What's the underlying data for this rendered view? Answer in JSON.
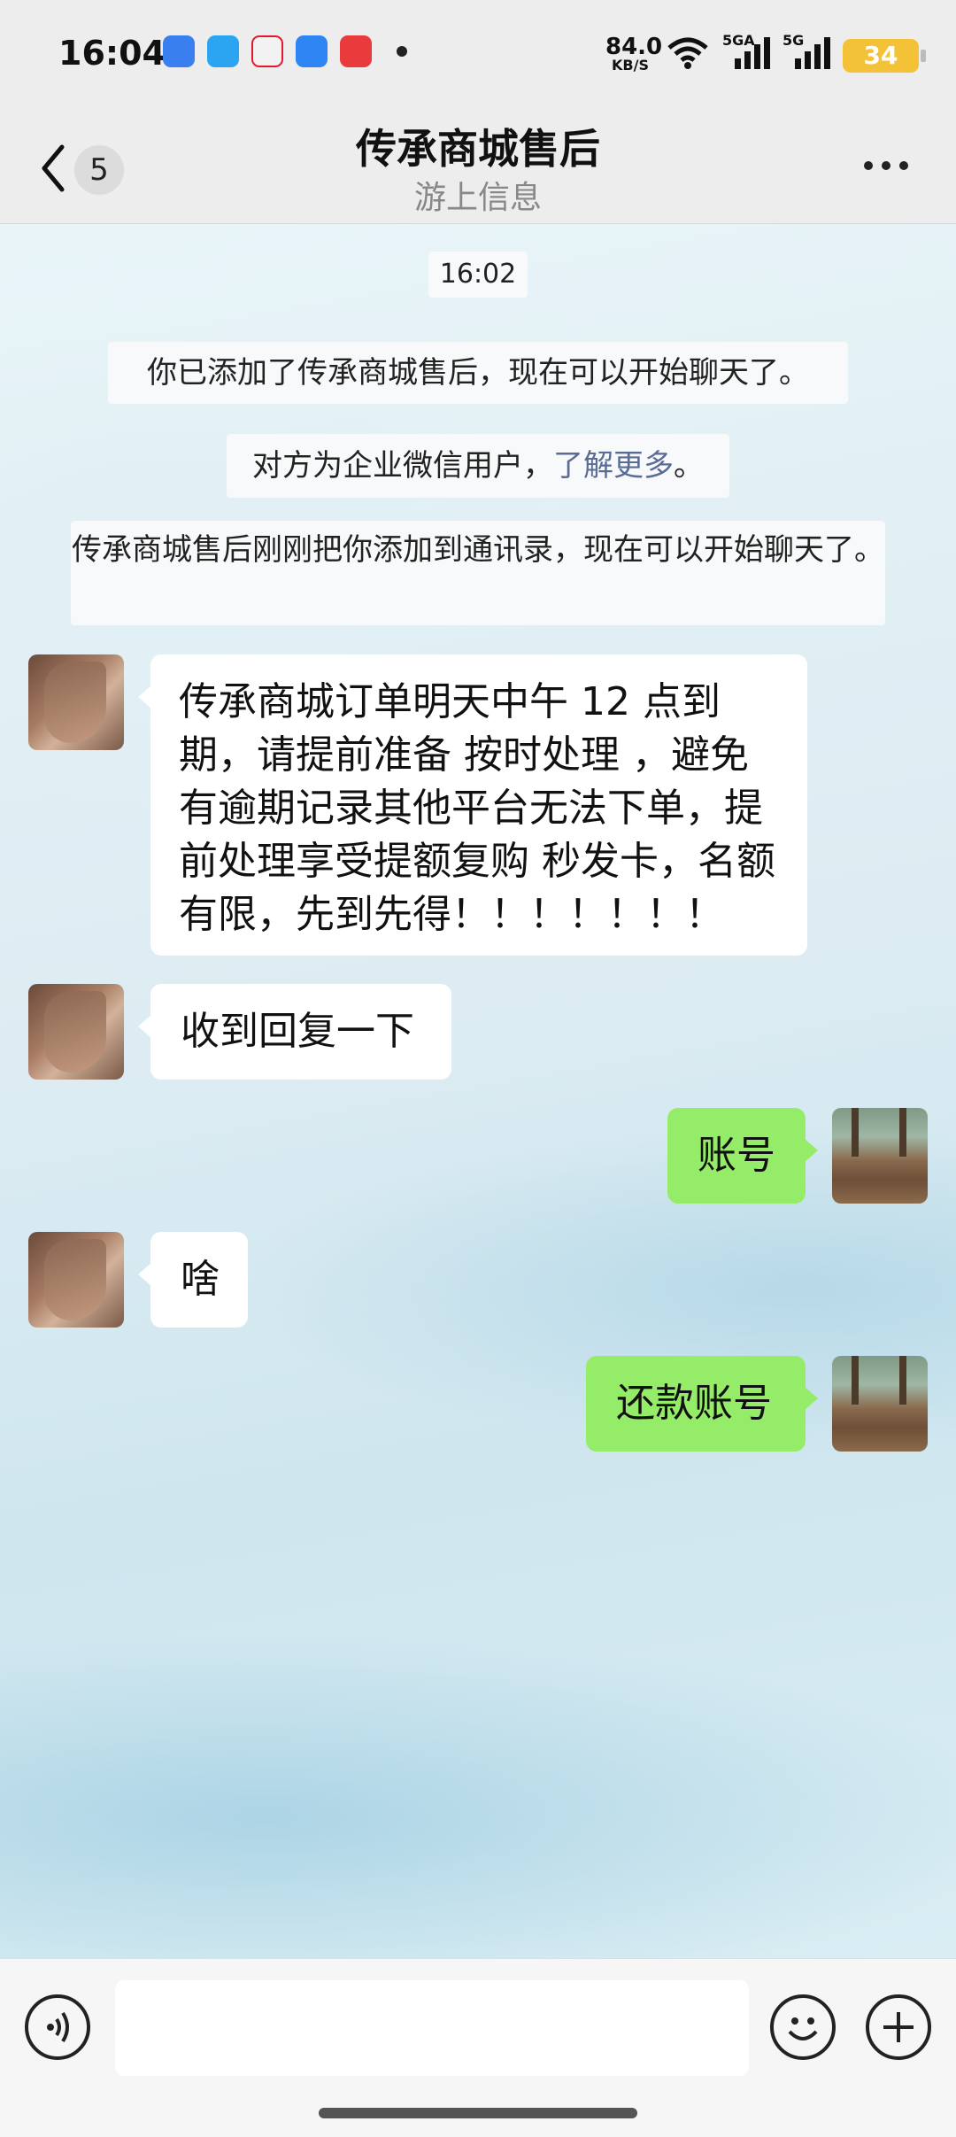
{
  "status_bar": {
    "time": "16:04",
    "net_speed_value": "84.0",
    "net_speed_unit": "KB/S",
    "signal1_label": "5GA",
    "signal2_label": "5G",
    "battery": "34",
    "app_icons": [
      "baidu-map-icon",
      "mobile-app-icon",
      "weibo-icon",
      "feather-icon",
      "618-sale-icon"
    ]
  },
  "nav": {
    "back_badge": "5",
    "title": "传承商城售后",
    "subtitle": "游上信息"
  },
  "chat": {
    "timestamp": "16:02",
    "system_added": "你已添加了传承商城售后，现在可以开始聊天了。",
    "system_wecom_prefix": "对方为企业微信用户，",
    "system_wecom_link": "了解更多",
    "system_wecom_suffix": "。",
    "system_contacts": "传承商城售后刚刚把你添加到通讯录，现在可以开始聊天了。",
    "messages": [
      {
        "side": "left",
        "text": "传承商城订单明天中午 12 点到期，请提前准备 按时处理 ，避免有逾期记录其他平台无法下单，提前处理享受提额复购 秒发卡，名额有限，先到先得！！！！！！！"
      },
      {
        "side": "left",
        "text": "收到回复一下"
      },
      {
        "side": "right",
        "text": "账号"
      },
      {
        "side": "left",
        "text": "啥"
      },
      {
        "side": "right",
        "text": "还款账号"
      }
    ]
  },
  "input_bar": {
    "text_value": ""
  },
  "colors": {
    "sent_bubble": "#95ec69",
    "received_bubble": "#ffffff",
    "link": "#5a6b96",
    "battery": "#f4c237"
  }
}
